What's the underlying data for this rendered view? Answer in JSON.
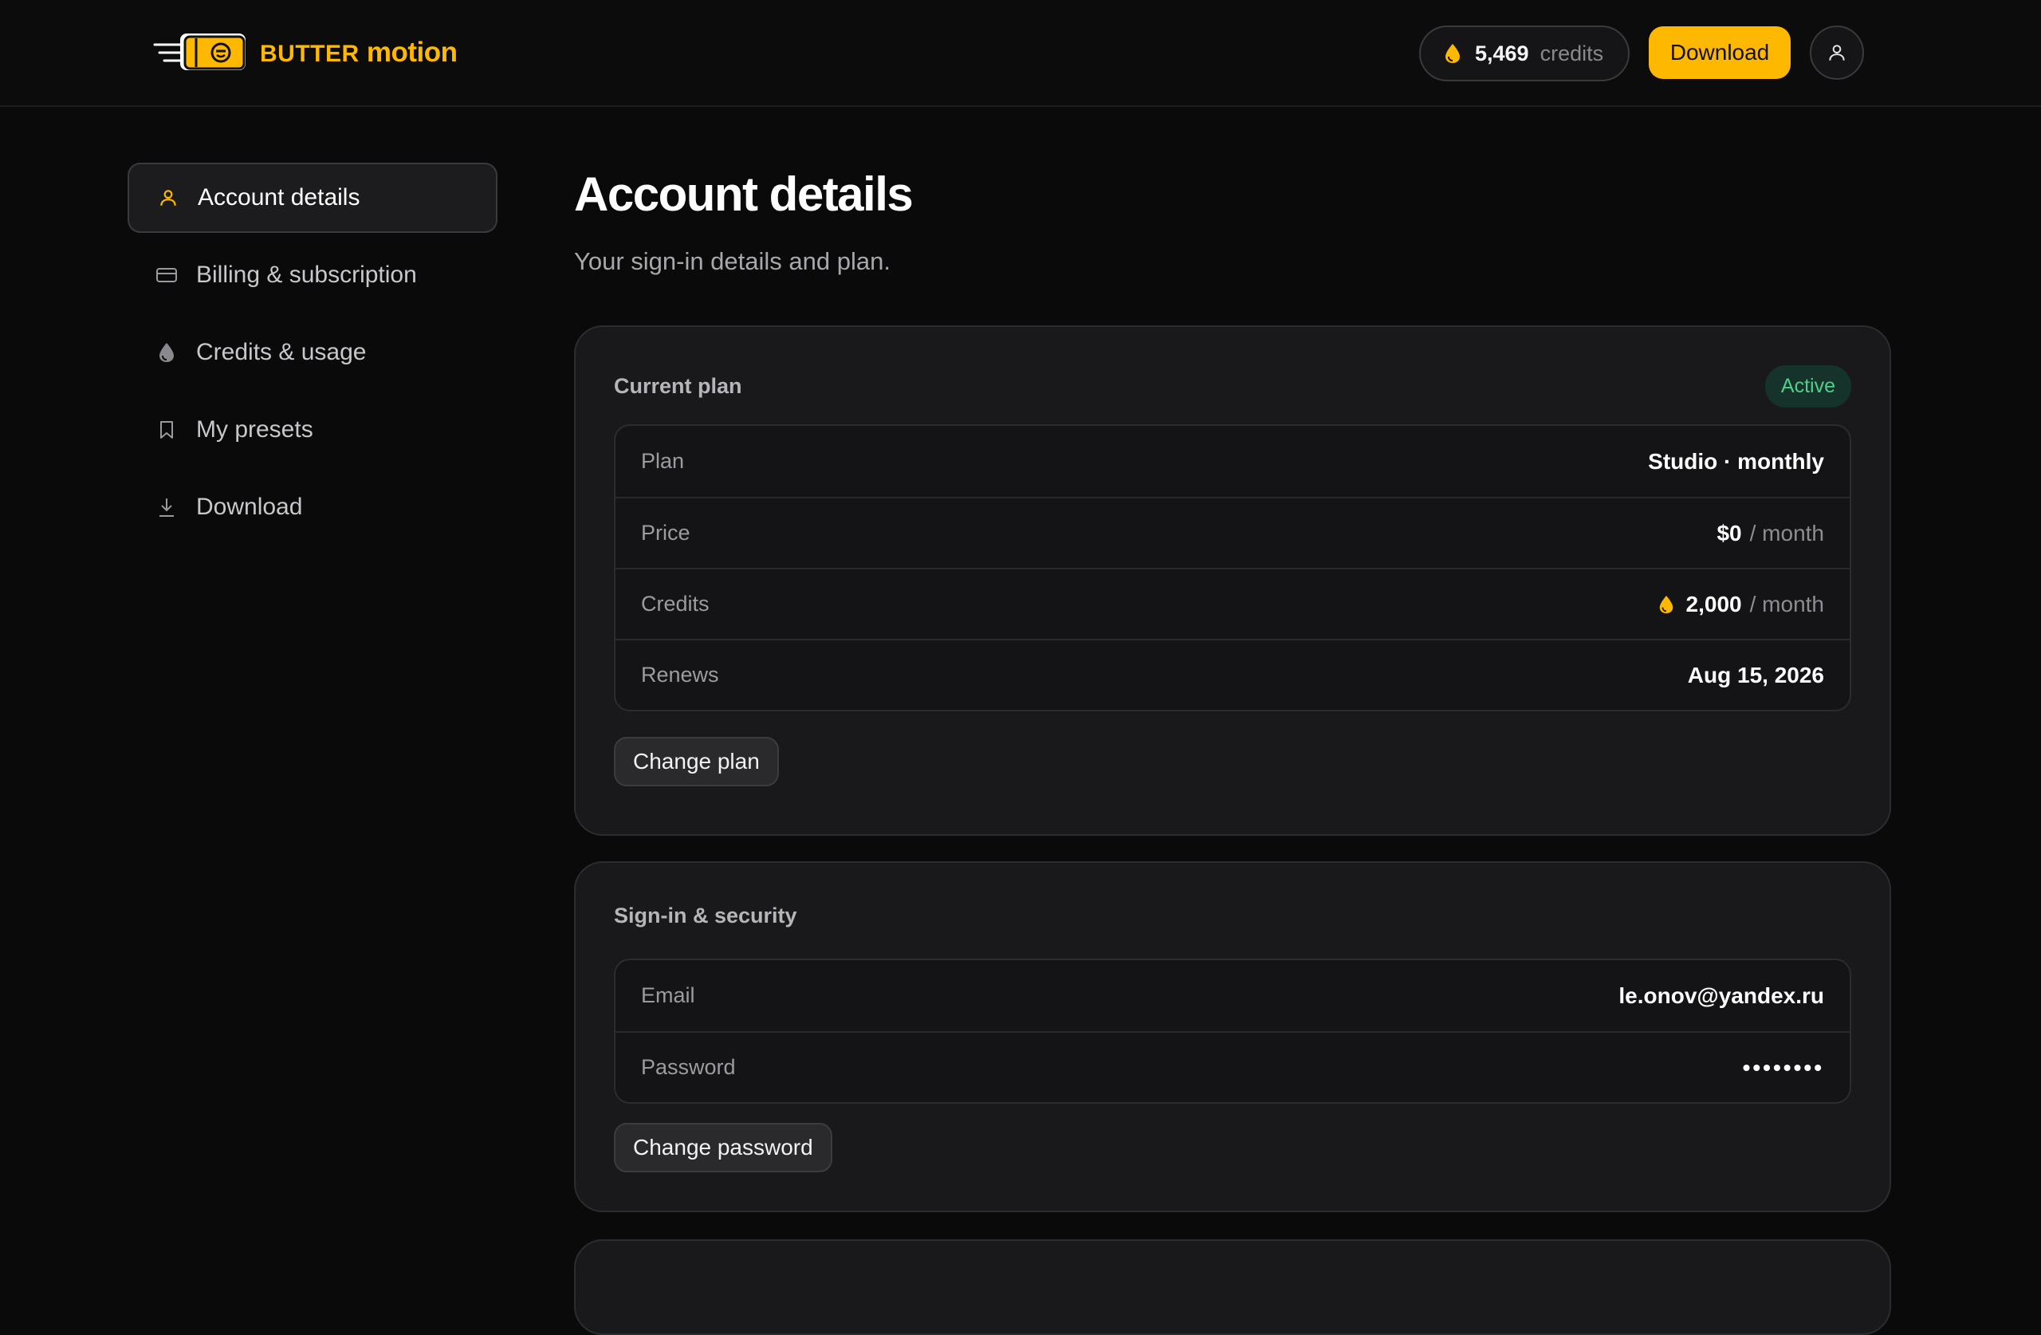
{
  "brand": {
    "name_part1": "BUTTER",
    "name_part2": "motion"
  },
  "header": {
    "credits_value": "5,469",
    "credits_label": "credits",
    "download_label": "Download"
  },
  "sidebar": {
    "items": [
      {
        "label": "Account details",
        "icon": "user-icon",
        "active": true
      },
      {
        "label": "Billing & subscription",
        "icon": "credit-card-icon"
      },
      {
        "label": "Credits & usage",
        "icon": "drop-icon"
      },
      {
        "label": "My presets",
        "icon": "bookmark-icon"
      },
      {
        "label": "Download",
        "icon": "download-icon"
      }
    ]
  },
  "main": {
    "title": "Account details",
    "subtitle": "Your sign-in details and plan.",
    "plan_card": {
      "title": "Current plan",
      "status": "Active",
      "rows": [
        {
          "key": "Plan",
          "value": "Studio · monthly"
        },
        {
          "key": "Price",
          "value": "$0",
          "suffix": "/ month"
        },
        {
          "key": "Credits",
          "value": "2,000",
          "suffix": "/ month"
        },
        {
          "key": "Renews",
          "value": "Aug 15, 2026"
        }
      ],
      "button": "Change plan"
    },
    "security_card": {
      "title": "Sign-in & security",
      "rows": [
        {
          "key": "Email",
          "value": "le.onov@yandex.ru"
        },
        {
          "key": "Password",
          "value": "••••••••"
        }
      ],
      "button": "Change password"
    }
  },
  "colors": {
    "accent": "#ffb800",
    "background": "#0a0a0b",
    "card": "#19191b",
    "active_badge_text": "#4fd08a",
    "active_badge_bg": "#15332a"
  }
}
